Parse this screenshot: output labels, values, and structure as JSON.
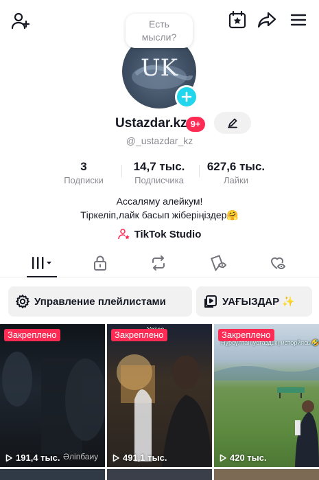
{
  "header": {
    "add_friend_icon": "person-plus",
    "calendar_icon": "calendar-star",
    "share_icon": "share-arrow",
    "menu_icon": "hamburger"
  },
  "thought_bubble": {
    "text": "Есть\nмысли?"
  },
  "profile": {
    "avatar_monogram": "UK",
    "username": "Ustazdar.kz",
    "notification_badge": "9+",
    "handle": "@_ustazdar_kz"
  },
  "stats": [
    {
      "value": "3",
      "label": "Подписки"
    },
    {
      "value": "14,7 тыс.",
      "label": "Подписчика"
    },
    {
      "value": "627,6 тыс.",
      "label": "Лайки"
    }
  ],
  "bio": {
    "line1": "Ассаляму алейкум!",
    "line2": "Тіркеліп,лайк басып жіберіңіздер🤗"
  },
  "studio_link": {
    "label": "TikTok Studio"
  },
  "tabs": [
    {
      "name": "videos",
      "icon": "grid-bars-icon",
      "active": true
    },
    {
      "name": "private",
      "icon": "lock-icon",
      "active": false
    },
    {
      "name": "reposts",
      "icon": "repost-icon",
      "active": false
    },
    {
      "name": "favorites",
      "icon": "bookmark-hidden-icon",
      "active": false
    },
    {
      "name": "liked",
      "icon": "heart-hidden-icon",
      "active": false
    }
  ],
  "actions": {
    "playlists_label": "Управление плейлистами",
    "playlists_icon": "gear-icon",
    "featured_label": "УАҒЫЗДАР ✨",
    "featured_icon": "playlist-icon"
  },
  "videos": [
    {
      "pinned_label": "Закреплено",
      "views": "191,4 тыс.",
      "caption": "Әліпбаиу"
    },
    {
      "pinned_label": "Закреплено",
      "views": "491,1 тыс.",
      "caption": "Устаз"
    },
    {
      "pinned_label": "Закреплено",
      "views": "420 тыс.",
      "caption": "Нұрсұлтан устаздың исторйясы🤣🤣🤣"
    }
  ],
  "colors": {
    "accent": "#fe2c55",
    "avatar_plus": "#20d5ec",
    "text_primary": "#161823",
    "text_secondary": "#8a8b91",
    "pill_bg": "#f1f1f2"
  }
}
